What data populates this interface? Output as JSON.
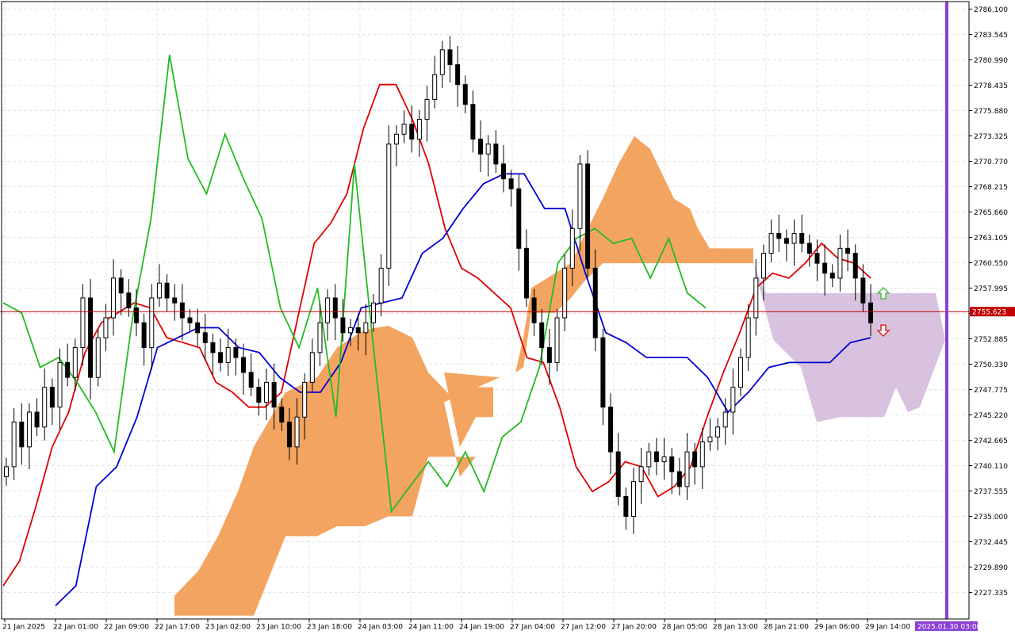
{
  "chart_data": {
    "type": "candlestick",
    "instrument_note": "",
    "current_price": 2755.623,
    "current_price_label": "2755.623",
    "cursor_date_label": "2025.01.30 03:00",
    "y_range": [
      2724.8,
      2787.4
    ],
    "y_ticks": [
      "2786.100",
      "2783.545",
      "2780.990",
      "2778.435",
      "2775.880",
      "2773.325",
      "2770.770",
      "2768.215",
      "2765.660",
      "2763.105",
      "2760.550",
      "2757.995",
      "2755.440",
      "2752.885",
      "2750.330",
      "2747.775",
      "2745.220",
      "2742.665",
      "2740.110",
      "2737.555",
      "2735.000",
      "2732.445",
      "2729.890",
      "2727.335"
    ],
    "x_ticks": [
      "21 Jan 2025",
      "22 Jan 01:00",
      "22 Jan 09:00",
      "22 Jan 17:00",
      "23 Jan 02:00",
      "23 Jan 10:00",
      "23 Jan 18:00",
      "24 Jan 03:00",
      "24 Jan 11:00",
      "24 Jan 19:00",
      "27 Jan 04:00",
      "27 Jan 12:00",
      "27 Jan 20:00",
      "28 Jan 05:00",
      "28 Jan 13:00",
      "28 Jan 21:00",
      "29 Jan 06:00",
      "29 Jan 14:00"
    ],
    "bars": [
      2740.0,
      2744.5,
      2742.0,
      2745.5,
      2744.0,
      2748.0,
      2746.0,
      2750.5,
      2749.0,
      2752.0,
      2757.0,
      2749.0,
      2753.0,
      2755.0,
      2759.0,
      2757.5,
      2756.0,
      2754.5,
      2752.0,
      2757.0,
      2758.5,
      2757.0,
      2756.5,
      2755.0,
      2754.5,
      2753.5,
      2752.5,
      2751.5,
      2750.5,
      2752.0,
      2751.0,
      2749.5,
      2748.0,
      2746.5,
      2748.5,
      2746.0,
      2744.5,
      2742.0,
      2745.0,
      2748.5,
      2751.5,
      2754.5,
      2757.0,
      2755.0,
      2753.5,
      2754.0,
      2753.5,
      2754.5,
      2756.5,
      2760.0,
      2772.5,
      2773.5,
      2774.5,
      2773.0,
      2775.0,
      2777.0,
      2779.5,
      2782.0,
      2780.5,
      2778.5,
      2776.5,
      2773.0,
      2771.5,
      2772.5,
      2770.5,
      2769.0,
      2768.0,
      2762.0,
      2757.0,
      2754.5,
      2752.0,
      2750.5,
      2755.0,
      2760.0,
      2764.0,
      2770.5,
      2760.0,
      2753.0,
      2746.0,
      2741.5,
      2737.0,
      2735.0,
      2738.5,
      2740.0,
      2741.5,
      2740.5,
      2741.0,
      2739.5,
      2738.0,
      2741.5,
      2740.0,
      2742.5,
      2743.0,
      2744.0,
      2745.5,
      2748.0,
      2751.0,
      2755.0,
      2759.0,
      2761.5,
      2763.5,
      2763.0,
      2762.5,
      2763.5,
      2762.5,
      2761.5,
      2760.5,
      2759.5,
      2759.0,
      2762.0,
      2761.5,
      2759.0,
      2756.5,
      2754.5
    ],
    "series": [
      {
        "name": "",
        "color": "#e00000",
        "values": [
          2728.0,
          2730.5,
          2736.0,
          2742.0,
          2745.5,
          2751.5,
          2754.5,
          2755.5,
          2756.5,
          2756.0,
          2753.0,
          2752.5,
          2752.0,
          2748.5,
          2747.5,
          2746.0,
          2746.0,
          2747.5,
          2755.0,
          2762.5,
          2764.5,
          2767.5,
          2774.0,
          2778.5,
          2778.5,
          2775.0,
          2770.5,
          2764.0,
          2760.0,
          2759.0,
          2757.5,
          2756.0,
          2751.0,
          2750.5,
          2746.0,
          2740.0,
          2737.5,
          2738.5,
          2740.5,
          2740.0,
          2737.0,
          2738.0,
          2740.0,
          2745.0,
          2749.5,
          2753.5,
          2758.0,
          2759.5,
          2759.0,
          2760.5,
          2762.5,
          2761.0,
          2760.5,
          2759.0
        ]
      },
      {
        "name": "",
        "color": "#0000d0",
        "values": [
          2726.0,
          2728.0,
          2738.0,
          2740.0,
          2745.0,
          2752.0,
          2753.0,
          2754.0,
          2754.0,
          2752.0,
          2751.5,
          2749.0,
          2747.5,
          2747.5,
          2750.5,
          2756.0,
          2756.5,
          2757.0,
          2761.5,
          2763.0,
          2766.0,
          2768.5,
          2769.5,
          2769.5,
          2766.0,
          2766.0,
          2759.5,
          2753.5,
          2752.5,
          2751.0,
          2751.0,
          2751.0,
          2749.0,
          2745.5,
          2747.5,
          2750.0,
          2750.5,
          2750.5,
          2750.5,
          2752.5,
          2753.0
        ]
      },
      {
        "name": "",
        "color": "#22bb22",
        "values": [
          2756.5,
          2755.5,
          2750.0,
          2751.0,
          2748.5,
          2745.5,
          2741.5,
          2755.0,
          2765.0,
          2781.5,
          2771.0,
          2767.5,
          2773.5,
          2769.0,
          2765.0,
          2756.0,
          2752.0,
          2758.0,
          2745.0,
          2770.5,
          2752.5,
          2735.5,
          2738.0,
          2740.5,
          2738.0,
          2741.5,
          2737.5,
          2743.0,
          2744.5,
          2750.0,
          2760.5,
          2763.0,
          2764.0,
          2762.5,
          2763.0,
          2759.0,
          2763.0,
          2757.5,
          2756.0
        ]
      }
    ],
    "cloud": {
      "colors": {
        "bullish": "#f4a461",
        "bearish": "#d8c2df"
      }
    },
    "signals": {
      "up_color": "#44bb44",
      "down_color": "#e02020"
    }
  }
}
